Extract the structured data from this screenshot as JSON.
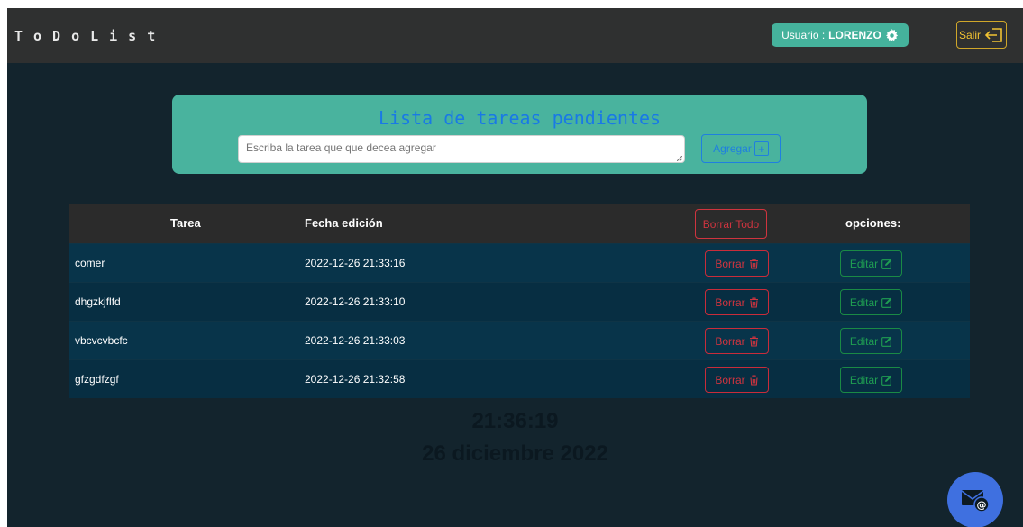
{
  "header": {
    "brand": "ToDoList",
    "user_label": "Usuario : ",
    "user_name": "LORENZO",
    "logout_label": "Salir"
  },
  "form": {
    "title": "Lista de tareas pendientes",
    "placeholder": "Escriba la tarea que que decea agregar",
    "add_label": "Agregar"
  },
  "table": {
    "col_task": "Tarea",
    "col_date": "Fecha edición",
    "delete_all_label": "Borrar Todo",
    "col_options": "opciones:",
    "delete_label": "Borrar",
    "edit_label": "Editar",
    "rows": [
      {
        "task": "comer",
        "date": "2022-12-26 21:33:16"
      },
      {
        "task": "dhgzkjflfd",
        "date": "2022-12-26 21:33:10"
      },
      {
        "task": "vbcvcvbcfc",
        "date": "2022-12-26 21:33:03"
      },
      {
        "task": "gfzgdfzgf",
        "date": "2022-12-26 21:32:58"
      }
    ]
  },
  "clock": {
    "time": "21:36:19",
    "date": "26 diciembre 2022"
  },
  "icons": {
    "settings": "gear-icon",
    "logout": "logout-icon",
    "add": "plus-square-icon",
    "delete": "trash-icon",
    "edit": "edit-square-icon",
    "contact": "mail-at-icon"
  },
  "colors": {
    "background": "#13242d",
    "topbar": "#2f3030",
    "panel": "#49b39e",
    "accent_blue": "#1f7fe0",
    "danger": "#d0343f",
    "success": "#1f9e52",
    "warning": "#f1c232"
  }
}
